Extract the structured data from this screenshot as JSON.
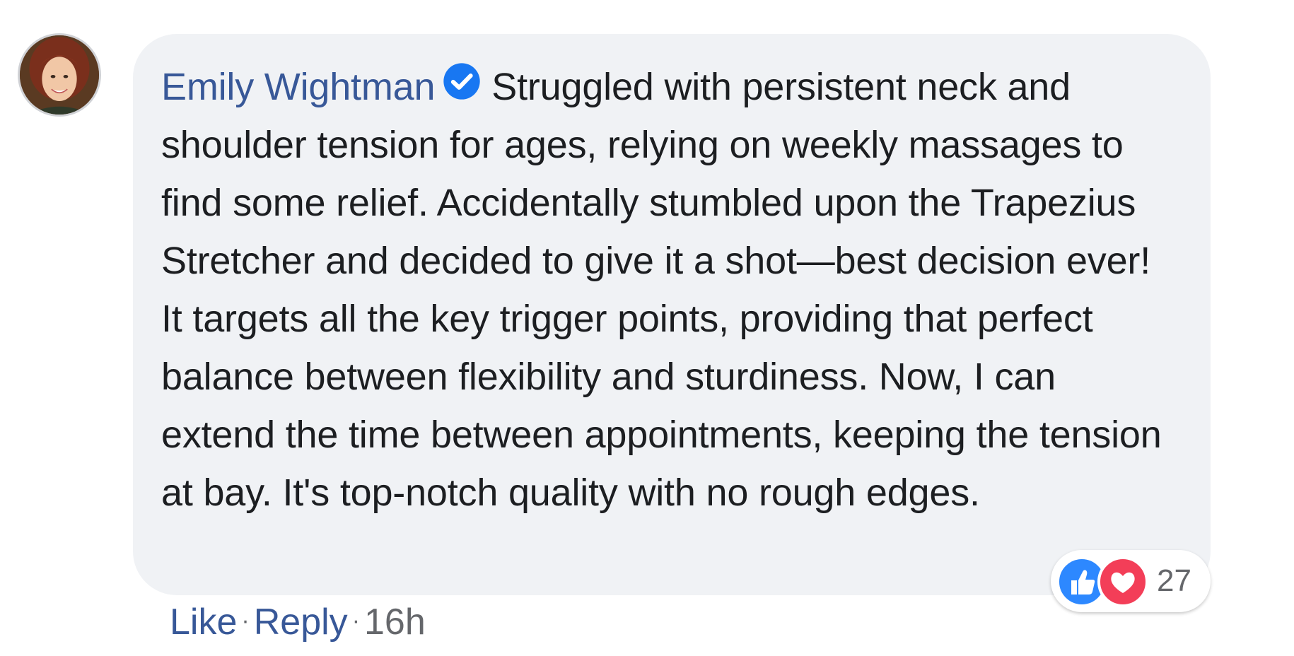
{
  "comment": {
    "author": "Emily Wightman",
    "verified_icon": "verified-check-icon",
    "text": "Struggled with persistent neck and shoulder tension for ages, relying on weekly massages to find some relief. Accidentally stumbled upon the Trapezius Stretcher and decided to give it a shot—best decision ever! It targets all the key trigger points, providing that perfect balance between flexibility and sturdiness. Now, I can extend the time between appointments, keeping the tension at bay. It's top-notch quality with no rough edges.",
    "reactions": {
      "icons": [
        "like-reaction-icon",
        "love-reaction-icon"
      ],
      "count": "27"
    },
    "actions": {
      "like": "Like",
      "separator": "·",
      "reply": "Reply",
      "time": "16h"
    }
  },
  "colors": {
    "bubble_bg": "#f0f2f5",
    "author": "#385898",
    "link": "#385898",
    "verified": "#1877f2",
    "like": "#2d88ff",
    "love": "#f33e58"
  }
}
